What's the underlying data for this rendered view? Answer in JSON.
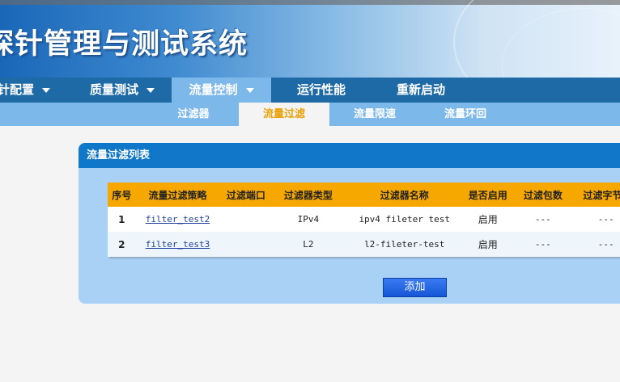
{
  "header": {
    "title": "探针管理与测试系统"
  },
  "nav": {
    "main": [
      {
        "label": "探针配置"
      },
      {
        "label": "质量测试"
      },
      {
        "label": "流量控制"
      },
      {
        "label": "运行性能"
      },
      {
        "label": "重新启动"
      }
    ],
    "sub": [
      {
        "label": "过滤器"
      },
      {
        "label": "流量过滤"
      },
      {
        "label": "流量限速"
      },
      {
        "label": "流量环回"
      }
    ],
    "active_main": "流量控制",
    "active_sub": "流量过滤"
  },
  "panel": {
    "title": "流量过滤列表",
    "columns": [
      "序号",
      "流量过滤策略",
      "过滤端口",
      "过滤器类型",
      "过滤器名称",
      "是否启用",
      "过滤包数",
      "过滤字节数"
    ],
    "rows": [
      {
        "seq": "1",
        "policy": "filter_test2",
        "port": "",
        "type": "IPv4",
        "name": "ipv4 fileter test",
        "enabled": "启用",
        "packets": "---",
        "bytes": "---"
      },
      {
        "seq": "2",
        "policy": "filter_test3",
        "port": "",
        "type": "L2",
        "name": "l2-fileter-test",
        "enabled": "启用",
        "packets": "---",
        "bytes": "---"
      }
    ],
    "add_label": "添加"
  },
  "colors": {
    "nav_bg": "#1d6aa6",
    "nav_active": "#7cb8ea",
    "header_orange": "#f7a800",
    "panel_bg": "#a8d1f5",
    "panel_head": "#1077c9",
    "sub_active_text": "#e9a20c"
  }
}
